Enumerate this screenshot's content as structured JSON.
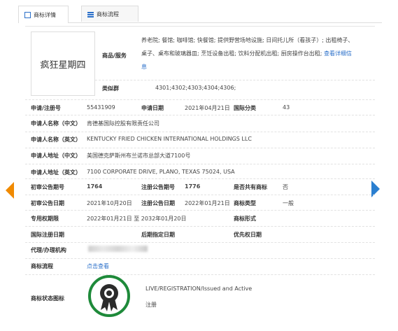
{
  "tabs": [
    {
      "label": "商标详情"
    },
    {
      "label": "商标流程"
    }
  ],
  "logo_text": "疯狂星期四",
  "goods_services": {
    "label": "商品/服务",
    "lines": [
      "养老院; 餐馆; 咖啡馆; 快餐馆; 提供野营场地设施; 日间托儿所（看孩子）; 出租椅子、",
      "桌子、桌布和玻璃器皿; 烹饪设备出租; 饮料分配机出租; 厨房操作台出租; "
    ],
    "more_link": "查看详细信",
    "more_link_tail": "息"
  },
  "similar_group": {
    "label": "类似群",
    "value": "4301;4302;4303;4304;4306;"
  },
  "app_no": {
    "label": "申请/注册号",
    "value": "55431909"
  },
  "app_date": {
    "label": "申请日期",
    "value": "2021年04月21日"
  },
  "intl_class": {
    "label": "国际分类",
    "value": "43"
  },
  "applicant_cn": {
    "label": "申请人名称（中文）",
    "value": "肯德基国际控股有限责任公司"
  },
  "applicant_en": {
    "label": "申请人名称（英文）",
    "value": "KENTUCKY FRIED CHICKEN INTERNATIONAL HOLDINGS LLC"
  },
  "address_cn": {
    "label": "申请人地址（中文）",
    "value": "美国德克萨斯州布兰诺市总部大道7100号"
  },
  "address_en": {
    "label": "申请人地址（英文）",
    "value": "7100 CORPORATE DRIVE, PLANO, TEXAS 75024, USA"
  },
  "prelim_no": {
    "label": "初审公告期号",
    "value": "1764"
  },
  "reg_no": {
    "label": "注册公告期号",
    "value": "1776"
  },
  "shared": {
    "label": "是否共有商标",
    "value": "否"
  },
  "prelim_date": {
    "label": "初审公告日期",
    "value": "2021年10月20日"
  },
  "reg_date": {
    "label": "注册公告日期",
    "value": "2022年01月21日"
  },
  "tm_type": {
    "label": "商标类型",
    "value": "一般"
  },
  "exclusive": {
    "label": "专用权期限",
    "value": "2022年01月21日 至 2032年01月20日"
  },
  "tm_form": {
    "label": "商标形式",
    "value": ""
  },
  "intl_reg_date": {
    "label": "国际注册日期",
    "value": ""
  },
  "later_date": {
    "label": "后期指定日期",
    "value": ""
  },
  "priority_date": {
    "label": "优先权日期",
    "value": ""
  },
  "agent": {
    "label": "代理/办理机构"
  },
  "flow": {
    "label": "商标流程",
    "link": "点击查看"
  },
  "status": {
    "label": "商标状态图标",
    "line1": "LIVE/REGISTRATION/Issued and Active",
    "line2": "注册"
  }
}
